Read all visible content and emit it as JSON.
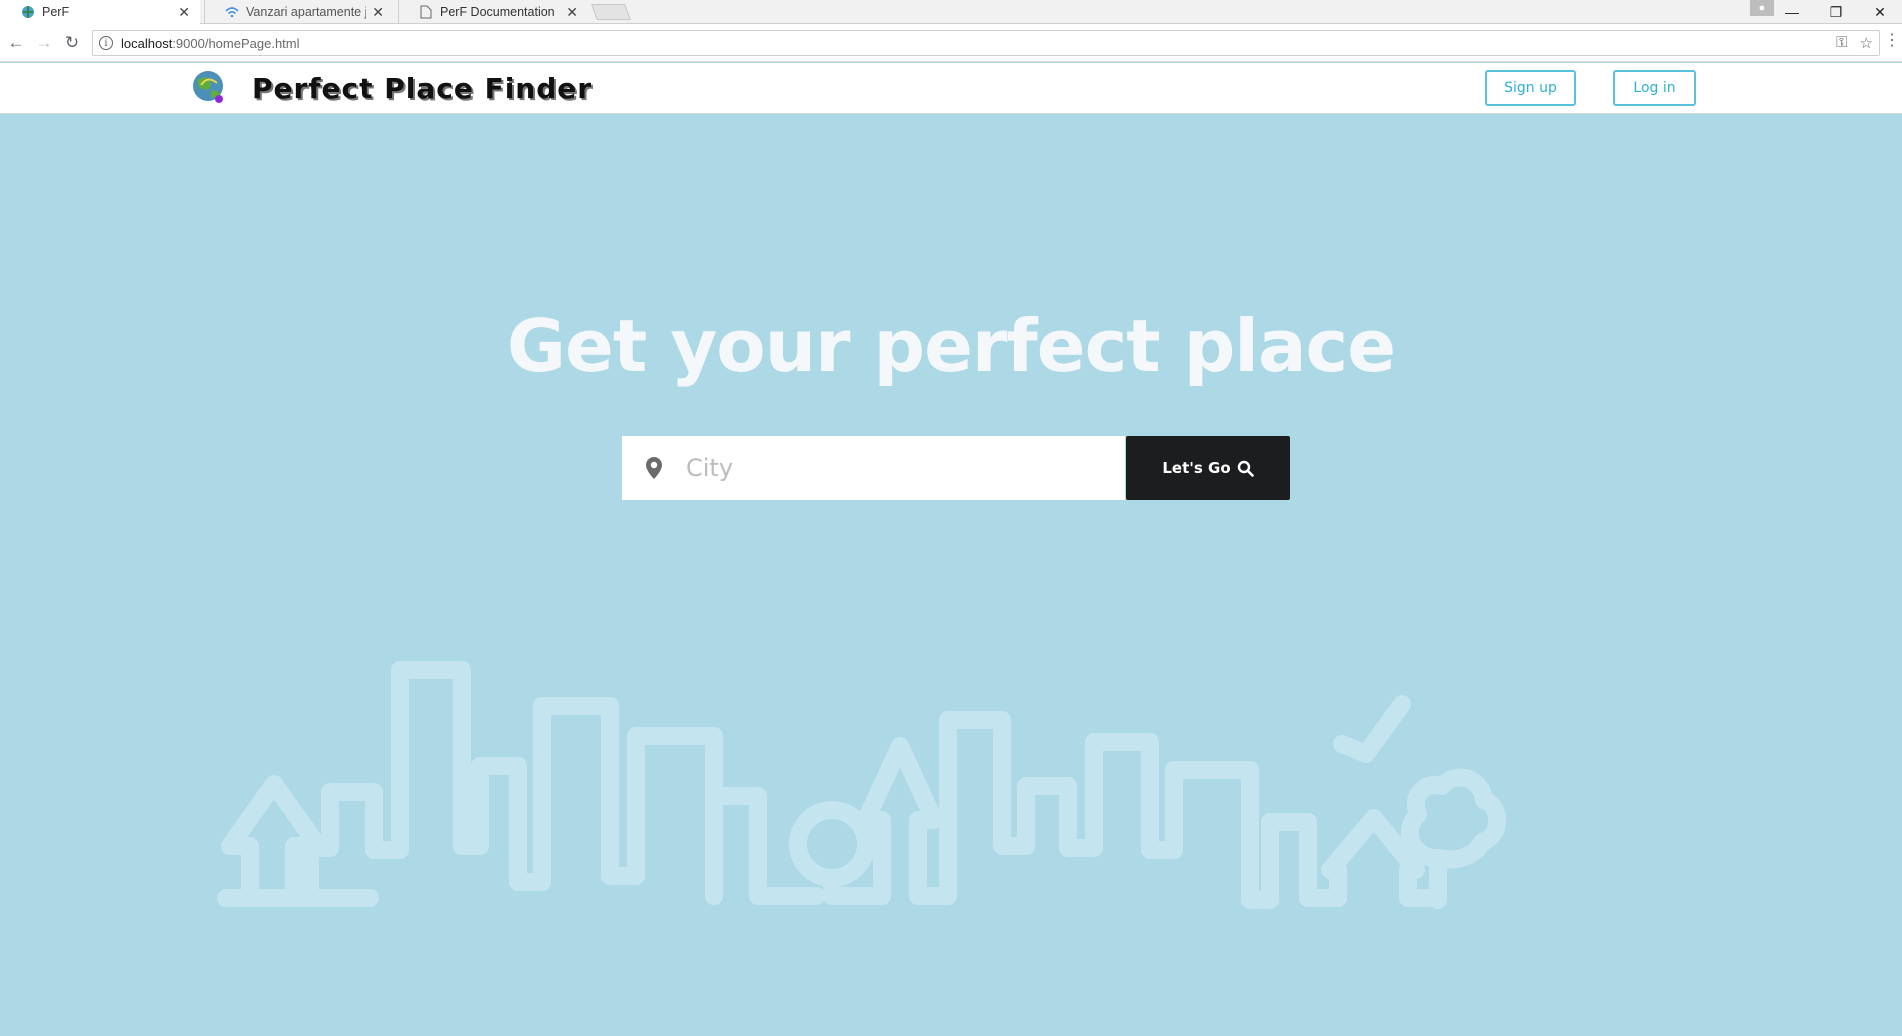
{
  "browser": {
    "tabs": [
      {
        "title": "PerF",
        "active": true
      },
      {
        "title": "Vanzari apartamente jude",
        "active": false
      },
      {
        "title": "PerF Documentation",
        "active": false
      }
    ],
    "url_host": "localhost",
    "url_rest": ":9000/homePage.html"
  },
  "header": {
    "logo_text": "Perfect Place Finder",
    "signup_label": "Sign up",
    "login_label": "Log in",
    "accent_color": "#5bc0de"
  },
  "hero": {
    "title": "Get your perfect place",
    "search_placeholder": "City",
    "go_label": "Let's Go",
    "background_color": "#add8e6"
  }
}
